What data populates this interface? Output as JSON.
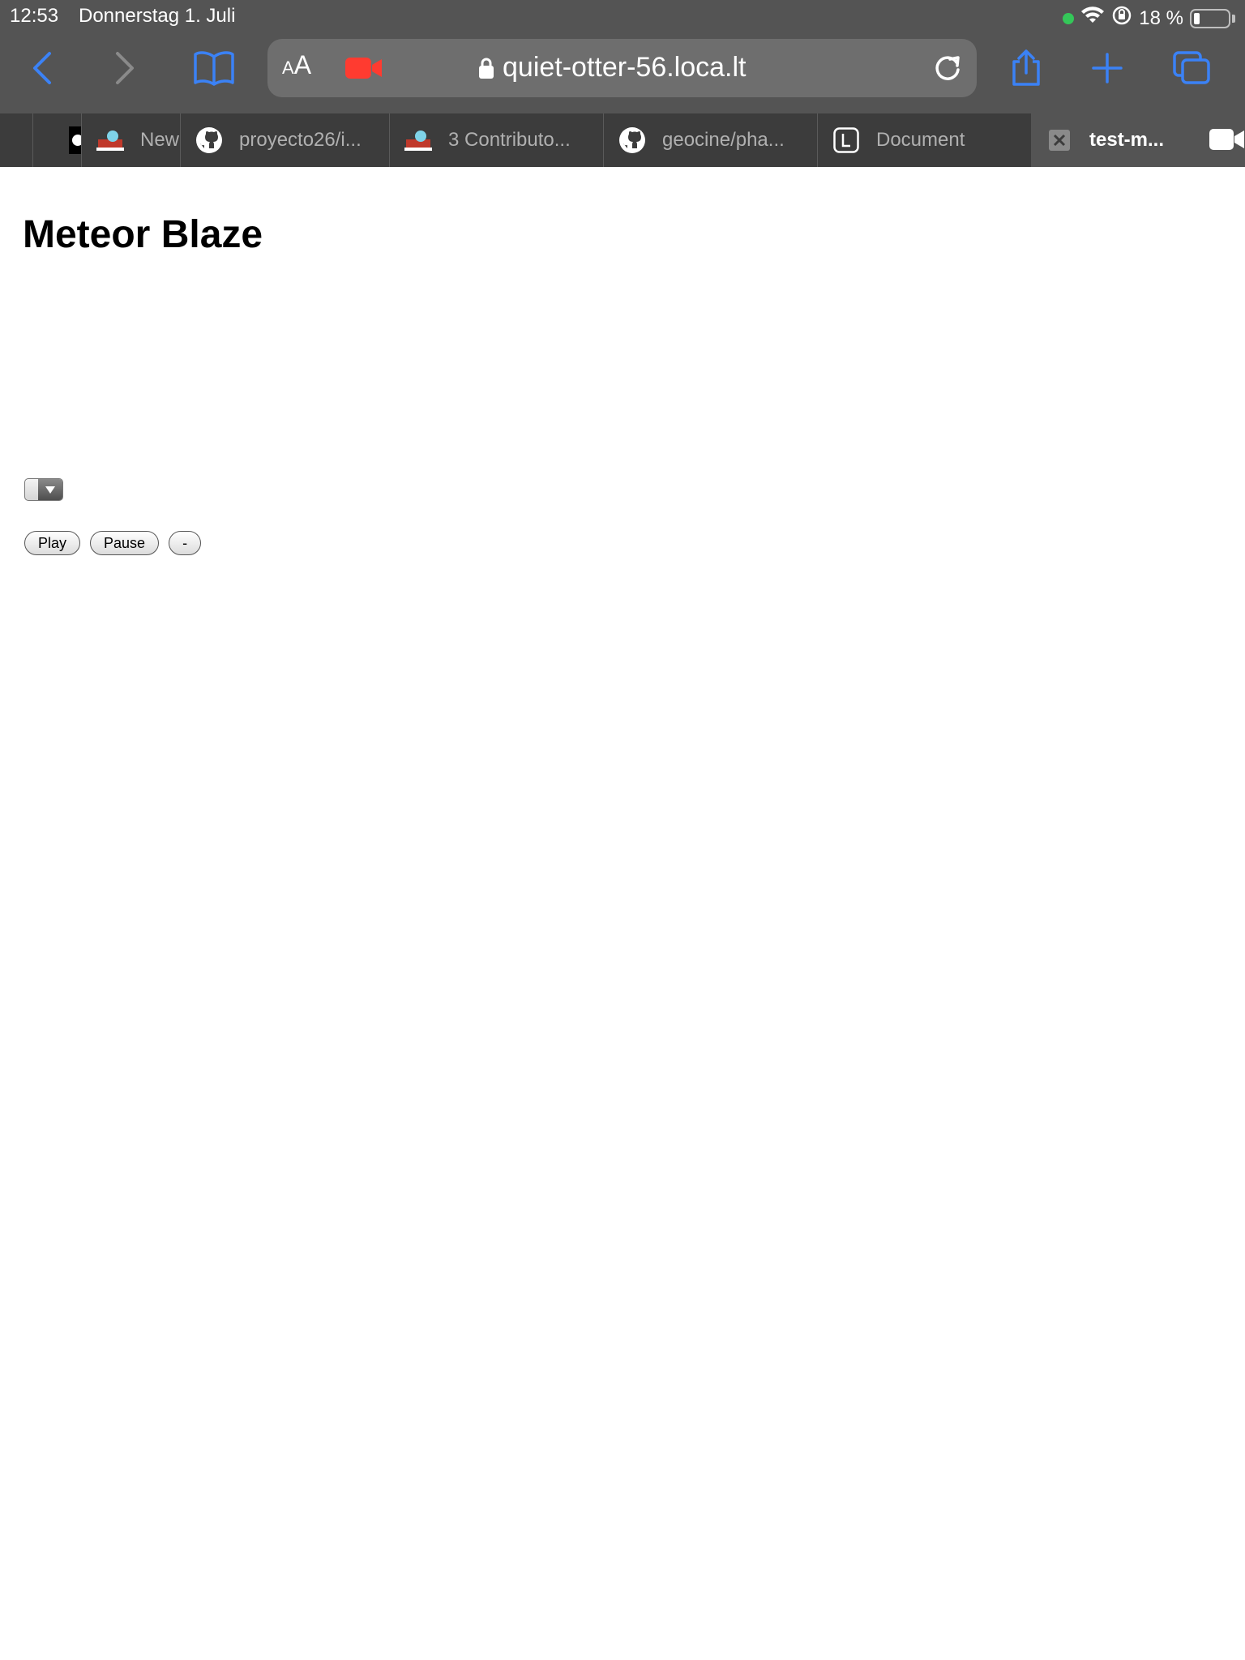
{
  "status_bar": {
    "time": "12:53",
    "date": "Donnerstag 1. Juli",
    "battery_text": "18 %",
    "battery_level": 0.18
  },
  "toolbar": {
    "aa_small": "A",
    "aa_big": "A",
    "url": "quiet-otter-56.loca.lt"
  },
  "tabs": [
    {
      "label": ""
    },
    {
      "label": "New"
    },
    {
      "label": "proyecto26/i..."
    },
    {
      "label": "3 Contributo..."
    },
    {
      "label": "geocine/pha..."
    },
    {
      "label": "Document"
    },
    {
      "label": "test-m..."
    }
  ],
  "page": {
    "title": "Meteor Blaze",
    "select_value": "",
    "play_label": "Play",
    "pause_label": "Pause",
    "minus_label": "-"
  },
  "colors": {
    "accent": "#3b82f6",
    "chrome_bg": "#545454",
    "tabbar_bg": "#3c3c3c",
    "record_red": "#ff3b30"
  }
}
